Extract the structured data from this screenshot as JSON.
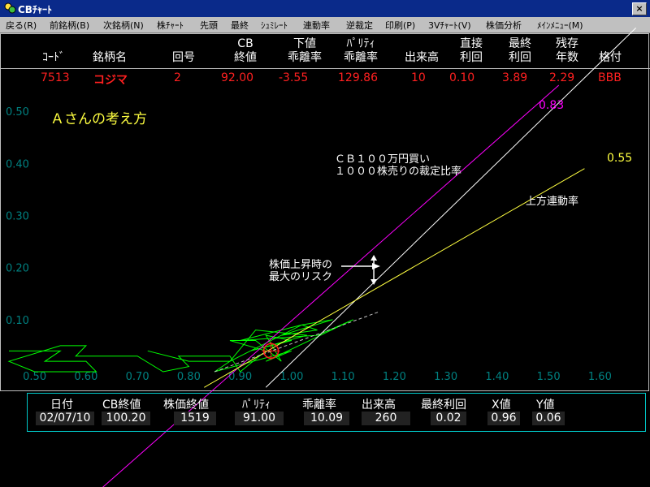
{
  "window": {
    "title": "CBﾁｬｰﾄ",
    "close": "×"
  },
  "menu": [
    "戻る(R)",
    "前銘柄(B)",
    "次銘柄(N)",
    "株ﾁｬｰﾄ",
    "先頭",
    "最終",
    "ｼｭﾐﾚｰﾄ",
    "連動率",
    "逆裁定",
    "印刷(P)",
    "3Vﾁｬｰﾄ(V)",
    "株価分析",
    "ﾒｲﾝﾒﾆｭｰ(M)"
  ],
  "header": {
    "code": "ｺｰﾄﾞ",
    "name": "銘柄名",
    "kaigo": "回号",
    "cb1": "CB",
    "cb2": "終値",
    "shita1": "下値",
    "shita2": "乖離率",
    "par1": "ﾊﾟﾘﾃｨ",
    "par2": "乖離率",
    "vol": "出来高",
    "choku1": "直接",
    "choku2": "利回",
    "sai1": "最終",
    "sai2": "利回",
    "zan1": "残存",
    "zan2": "年数",
    "rating": "格付"
  },
  "row": {
    "code": "7513",
    "name": "コジマ",
    "kaigo": "2",
    "cb": "92.00",
    "shita": "-3.55",
    "parity_div": "129.86",
    "vol": "10",
    "direct": "0.10",
    "final": "3.89",
    "years": "2.29",
    "rating": "BBB"
  },
  "annotations": {
    "heading": "Ａさんの考え方",
    "ratio1": "ＣＢ１００万円買い",
    "ratio2": "１０００株売りの裁定比率",
    "upper": "上方連動率",
    "risk1": "株価上昇時の",
    "risk2": "最大のリスク",
    "val_magenta": "0.83",
    "val_yellow": "0.55"
  },
  "colors": {
    "magenta": "#ff00ff",
    "yellow": "#ffff40",
    "green": "#00ff00",
    "axis": "#008080",
    "red": "#ff2020"
  },
  "chart_data": {
    "type": "line",
    "x_ticks": [
      "0.50",
      "0.60",
      "0.70",
      "0.80",
      "0.90",
      "1.00",
      "1.10",
      "1.20",
      "1.30",
      "1.40",
      "1.50",
      "1.60"
    ],
    "y_ticks": [
      "0.50",
      "0.40",
      "0.30",
      "0.20",
      "0.10"
    ],
    "xlim": [
      0.45,
      1.65
    ],
    "ylim": [
      0.0,
      0.55
    ],
    "lines": [
      {
        "color": "#ff00ff",
        "points": [
          [
            0.6,
            -0.25
          ],
          [
            1.52,
            0.55
          ]
        ]
      },
      {
        "color": "#ffffff",
        "points": [
          [
            0.95,
            -0.03
          ],
          [
            1.67,
            0.66
          ]
        ]
      },
      {
        "color": "#ffff40",
        "points": [
          [
            0.83,
            -0.03
          ],
          [
            1.57,
            0.39
          ]
        ]
      }
    ],
    "dashed": [
      [
        0.85,
        0.0
      ],
      [
        1.17,
        0.115
      ]
    ],
    "target": [
      0.96,
      0.04
    ],
    "risk_arrow_x": 1.16,
    "green_trace": [
      [
        0.45,
        0.04
      ],
      [
        0.55,
        0.04
      ],
      [
        0.52,
        0.02
      ],
      [
        0.6,
        0.02
      ],
      [
        0.62,
        0.0
      ],
      [
        0.5,
        0.0
      ],
      [
        0.45,
        0.02
      ],
      [
        0.55,
        0.05
      ],
      [
        0.6,
        0.05
      ],
      [
        0.58,
        0.03
      ],
      [
        0.7,
        0.03
      ],
      [
        0.75,
        0.0
      ],
      [
        0.8,
        0.01
      ],
      [
        0.78,
        0.03
      ],
      [
        0.88,
        0.03
      ],
      [
        0.9,
        0.0
      ],
      [
        0.95,
        0.04
      ],
      [
        0.88,
        0.06
      ],
      [
        0.93,
        0.06
      ],
      [
        0.98,
        0.02
      ],
      [
        0.95,
        0.07
      ],
      [
        1.0,
        0.06
      ],
      [
        0.92,
        0.04
      ],
      [
        1.03,
        0.07
      ],
      [
        0.93,
        0.08
      ],
      [
        0.88,
        0.02
      ],
      [
        1.02,
        0.09
      ],
      [
        1.05,
        0.08
      ],
      [
        0.98,
        0.07
      ],
      [
        1.08,
        0.1
      ],
      [
        1.02,
        0.09
      ],
      [
        0.9,
        0.06
      ],
      [
        1.05,
        0.07
      ],
      [
        1.12,
        0.1
      ],
      [
        0.95,
        0.02
      ],
      [
        1.0,
        0.04
      ],
      [
        0.85,
        0.0
      ],
      [
        0.88,
        0.02
      ],
      [
        0.8,
        0.02
      ],
      [
        0.72,
        0.04
      ]
    ]
  },
  "status": {
    "labels": [
      "日付",
      "CB終値",
      "株価終値",
      "ﾊﾟﾘﾃｨ",
      "乖離率",
      "出来高",
      "最終利回",
      "X値",
      "Y値"
    ],
    "values": [
      "02/07/10",
      "100.20",
      "1519",
      "91.00",
      "10.09",
      "260",
      "0.02",
      "0.96",
      "0.06"
    ]
  }
}
